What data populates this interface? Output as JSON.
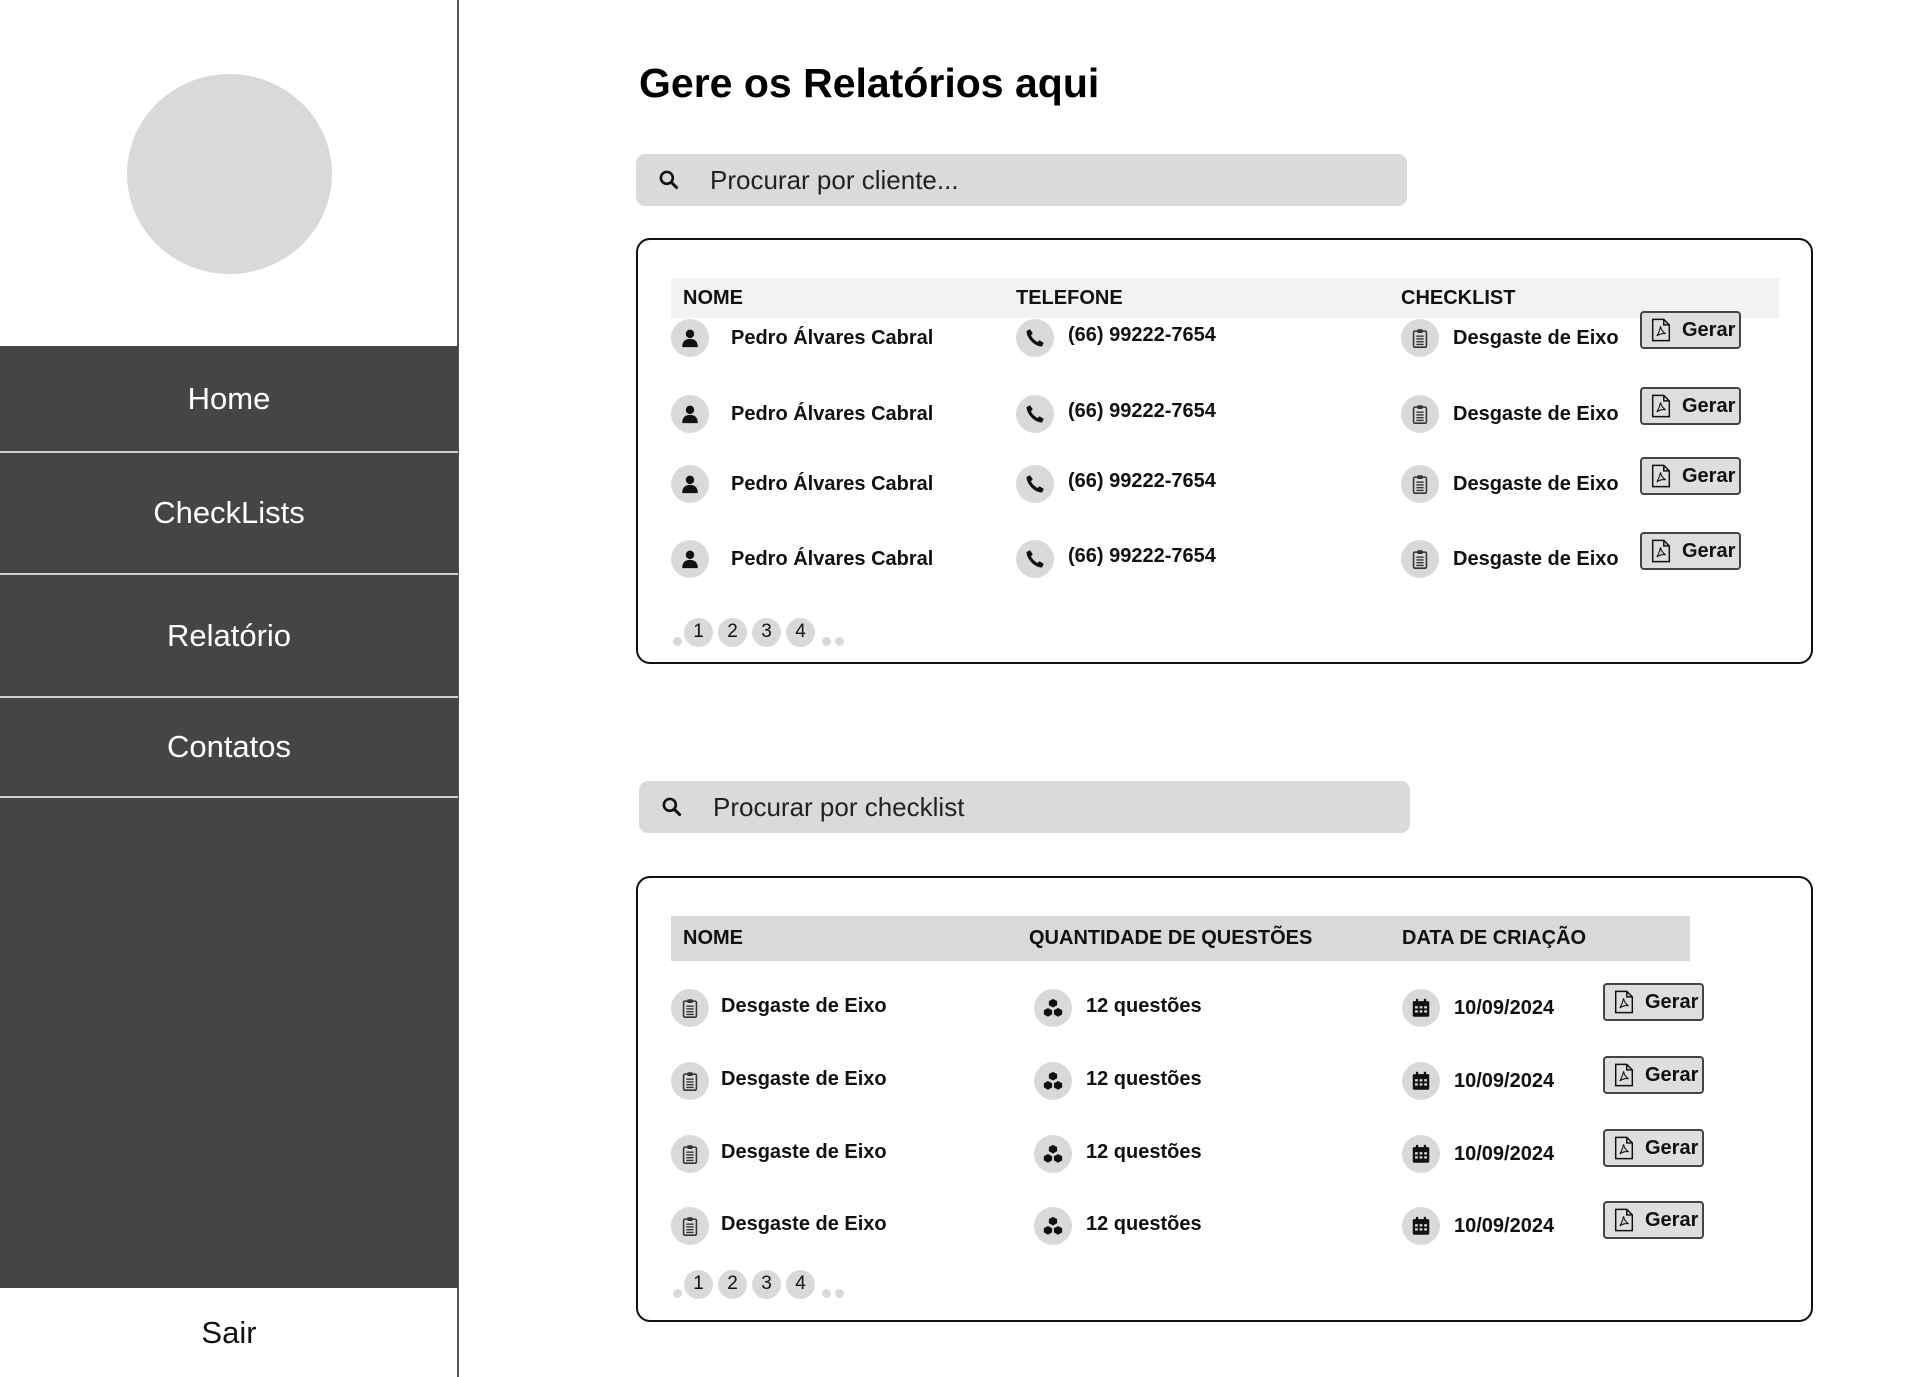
{
  "sidebar": {
    "nav": [
      {
        "label": "Home"
      },
      {
        "label": "CheckLists"
      },
      {
        "label": "Relatório"
      },
      {
        "label": "Contatos"
      }
    ],
    "logout_label": "Sair"
  },
  "main": {
    "title": "Gere os Relatórios aqui",
    "client_search": {
      "placeholder": "Procurar por cliente..."
    },
    "clients_table": {
      "headers": [
        "NOME",
        "TELEFONE",
        "CHECKLIST"
      ],
      "rows": [
        {
          "name": "Pedro Álvares Cabral",
          "phone": "(66) 99222-7654",
          "checklist": "Desgaste de Eixo",
          "action": "Gerar"
        },
        {
          "name": "Pedro Álvares Cabral",
          "phone": "(66) 99222-7654",
          "checklist": "Desgaste de Eixo",
          "action": "Gerar"
        },
        {
          "name": "Pedro Álvares Cabral",
          "phone": "(66) 99222-7654",
          "checklist": "Desgaste de Eixo",
          "action": "Gerar"
        },
        {
          "name": "Pedro Álvares Cabral",
          "phone": "(66) 99222-7654",
          "checklist": "Desgaste de Eixo",
          "action": "Gerar"
        }
      ],
      "pages": [
        "1",
        "2",
        "3",
        "4"
      ]
    },
    "checklist_search": {
      "placeholder": "Procurar por checklist"
    },
    "checklists_table": {
      "headers": [
        "NOME",
        "QUANTIDADE DE QUESTÕES",
        "DATA DE CRIAÇÃO"
      ],
      "rows": [
        {
          "name": "Desgaste de Eixo",
          "questions": "12 questões",
          "date": "10/09/2024",
          "action": "Gerar"
        },
        {
          "name": "Desgaste de Eixo",
          "questions": "12 questões",
          "date": "10/09/2024",
          "action": "Gerar"
        },
        {
          "name": "Desgaste de Eixo",
          "questions": "12 questões",
          "date": "10/09/2024",
          "action": "Gerar"
        },
        {
          "name": "Desgaste de Eixo",
          "questions": "12 questões",
          "date": "10/09/2024",
          "action": "Gerar"
        }
      ],
      "pages": [
        "1",
        "2",
        "3",
        "4"
      ]
    }
  },
  "icons": {
    "search": "search-icon",
    "user": "user-icon",
    "phone": "phone-icon",
    "clipboard": "clipboard-icon",
    "pdf": "pdf-file-icon",
    "cubes": "cubes-icon",
    "calendar": "calendar-icon"
  },
  "colors": {
    "sidebar_bg": "#454545",
    "input_bg": "#dadada",
    "icon_bg": "#d9d9d9",
    "header_bg_clients": "#f2f2f2",
    "header_bg_checklists": "#d9d9d9"
  }
}
